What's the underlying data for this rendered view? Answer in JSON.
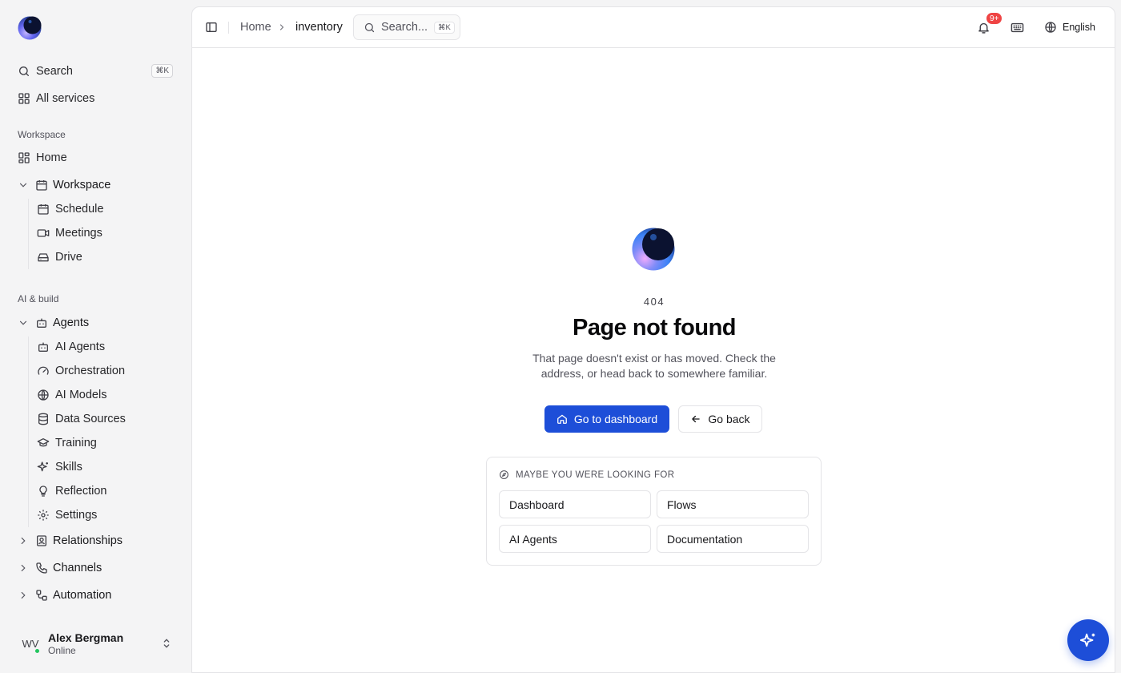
{
  "sidebar": {
    "search": {
      "label": "Search",
      "shortcut": "⌘K"
    },
    "all_services": "All services",
    "section_workspace": "Workspace",
    "home": "Home",
    "workspace_group": {
      "label": "Workspace",
      "items": [
        {
          "label": "Schedule",
          "icon": "calendar-icon"
        },
        {
          "label": "Meetings",
          "icon": "video-icon"
        },
        {
          "label": "Drive",
          "icon": "drive-icon"
        }
      ]
    },
    "section_ai": "AI & build",
    "agents_group": {
      "label": "Agents",
      "items": [
        {
          "label": "AI Agents",
          "icon": "bot-icon"
        },
        {
          "label": "Orchestration",
          "icon": "gauge-icon"
        },
        {
          "label": "AI Models",
          "icon": "globe-icon"
        },
        {
          "label": "Data Sources",
          "icon": "database-icon"
        },
        {
          "label": "Training",
          "icon": "graduation-cap-icon"
        },
        {
          "label": "Skills",
          "icon": "sparkles-icon"
        },
        {
          "label": "Reflection",
          "icon": "lightbulb-icon"
        },
        {
          "label": "Settings",
          "icon": "gear-icon"
        }
      ]
    },
    "collapsed_groups": [
      {
        "label": "Relationships",
        "icon": "contacts-icon"
      },
      {
        "label": "Channels",
        "icon": "phone-icon"
      },
      {
        "label": "Automation",
        "icon": "workflow-icon"
      }
    ],
    "user": {
      "initials": "WV",
      "name": "Alex Bergman",
      "status": "Online",
      "status_color": "#22c55e"
    }
  },
  "topbar": {
    "breadcrumb_home": "Home",
    "breadcrumb_current": "inventory",
    "search_placeholder": "Search...",
    "search_shortcut": "⌘K",
    "notification_badge": "9+",
    "language": "English"
  },
  "not_found": {
    "code": "404",
    "title": "Page not found",
    "description": "That page doesn't exist or has moved. Check the address, or head back to somewhere familiar.",
    "primary_button": "Go to dashboard",
    "secondary_button": "Go back",
    "suggestions_heading": "MAYBE YOU WERE LOOKING FOR",
    "suggestions": [
      "Dashboard",
      "Flows",
      "AI Agents",
      "Documentation"
    ]
  },
  "colors": {
    "accent": "#1d4ed8",
    "badge": "#ef4444",
    "sidebar_bg": "#f4f4f5"
  }
}
